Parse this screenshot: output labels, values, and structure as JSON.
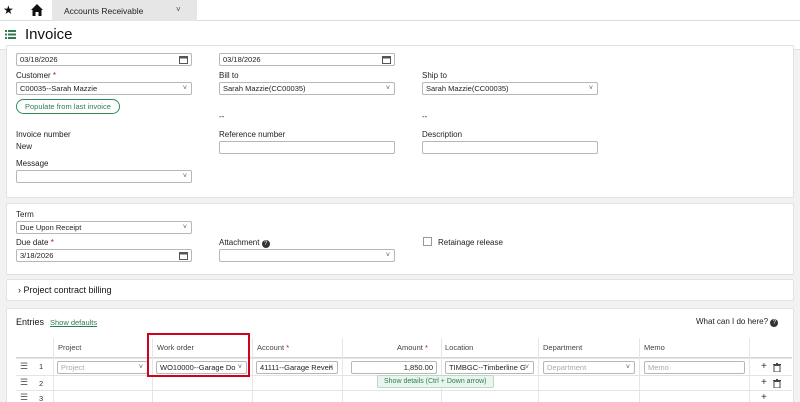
{
  "topnav": {
    "app_module": "Accounts Receivable"
  },
  "page": {
    "title": "Invoice"
  },
  "header": {
    "date_value": "03/18/2026",
    "date2_value": "03/18/2026",
    "customer_label": "Customer",
    "customer_value": "C00035--Sarah Mazzie",
    "populate_button": "Populate from last invoice",
    "bill_to_label": "Bill to",
    "bill_to_value": "Sarah Mazzie(CC00035)",
    "bill_to_dash": "--",
    "ship_to_label": "Ship to",
    "ship_to_value": "Sarah Mazzie(CC00035)",
    "ship_to_dash": "--",
    "invoice_number_label": "Invoice number",
    "invoice_number_value": "New",
    "reference_number_label": "Reference number",
    "description_label": "Description",
    "message_label": "Message"
  },
  "terms": {
    "term_label": "Term",
    "term_value": "Due Upon Receipt",
    "due_date_label": "Due date",
    "due_date_value": "3/18/2026",
    "attachment_label": "Attachment",
    "retainage_label": "Retainage release"
  },
  "project_billing": {
    "title": "Project contract billing"
  },
  "entries": {
    "title": "Entries",
    "show_defaults": "Show defaults",
    "help_text": "What can I do here?",
    "columns": {
      "project": "Project",
      "work_order": "Work order",
      "account": "Account",
      "amount": "Amount",
      "location": "Location",
      "department": "Department",
      "memo": "Memo"
    },
    "row1": {
      "num": "1",
      "project_placeholder": "Project",
      "work_order": "WO10000--Garage Do",
      "account": "41111--Garage Reven",
      "amount": "1,850.00",
      "location": "TIMBGC--Timberline G",
      "department_placeholder": "Department",
      "memo_placeholder": "Memo"
    },
    "row2": {
      "num": "2"
    },
    "row3": {
      "num": "3"
    },
    "tooltip": "Show details (Ctrl + Down arrow)"
  }
}
